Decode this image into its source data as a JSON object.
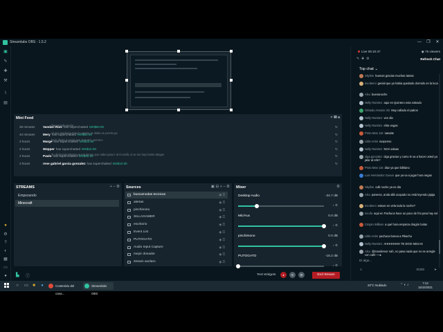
{
  "window": {
    "title": "Streamlabs OBS - 1.5.2",
    "controls": [
      "—",
      "❐",
      "✕"
    ]
  },
  "nav": {
    "items": [
      "studio-icon",
      "editor-icon",
      "themes-icon",
      "apps-icon",
      "stats-icon",
      "layout-icon"
    ],
    "bottom_items": [
      "dashboard-icon",
      "settings-icon",
      "help-icon",
      "theme-icon",
      "grid-icon",
      "chat-icon",
      "user-icon"
    ]
  },
  "mini_feed": {
    "title": "Mini Feed",
    "tools": "⏷  ❚❚  ■",
    "rows": [
      {
        "time": "39 minutes",
        "user": "Vandari Rios",
        "verb": "has superchatted",
        "amount": "MX$50.00",
        "message": "diner madrugador"
      },
      {
        "time": "43 minutes",
        "user": "Mery",
        "verb": "has superchatted",
        "amount": "MX$50.00",
        "message": "Al que madruga Dios lo ayuda, la diaba un perrito pa"
      },
      {
        "time": "3 hours",
        "user": "Marge",
        "verb": "has superchatted",
        "amount": "MX$20.00",
        "message": "ke le digan a Linsa que ama ES, Homero"
      },
      {
        "time": "2 hours",
        "user": "Wepper",
        "verb": "has superchatted",
        "amount": "MX$10.00",
        "message": ""
      },
      {
        "time": "2 hours",
        "user": "Paulo",
        "verb": "has superchatted",
        "amount": "MX$50.00",
        "message": "Tu dicionario Megas ya me tienes que caliar para ir al Crossfit, si se me hay bonito Megas"
      },
      {
        "time": "3 hours",
        "user": "rene gabriel garcia gonzalez",
        "verb": "has superchatted",
        "amount": "MX$10.00",
        "message": ""
      }
    ]
  },
  "scenes": {
    "title": "STREAMS",
    "tools": "+  −  ⚙",
    "items": [
      "Empezando",
      "Minecraft"
    ],
    "active": 1
  },
  "sources": {
    "title": "Sources",
    "tools": "▣  ⊟  +  −  ⚙",
    "items": [
      "buscamodas tecnicas",
      "alertas",
      "pinchinono",
      "SILLAGAMER",
      "escritorio",
      "Event List",
      "PUTOGATO",
      "Audio Input Capture",
      "mejor donador",
      "stream avelaro"
    ],
    "active": 0
  },
  "mixer": {
    "title": "Mixer",
    "tools": "⚙",
    "channels": [
      {
        "name": "Desktop Audio",
        "db": "-34.7 dB",
        "level": 0.22
      },
      {
        "name": "Mic/Aux",
        "db": "0.0 dB",
        "level": 1.0
      },
      {
        "name": "pinchimono",
        "db": "0.0 dB",
        "level": 1.0
      },
      {
        "name": "PUTOGATO",
        "db": "-18.2 dB",
        "level": 0.0
      }
    ]
  },
  "footer": {
    "test_widgets": "Test Widgets",
    "end_stream": "End Stream"
  },
  "chat": {
    "live": "Live 06:10:47",
    "viewers": "75 viewers",
    "refresh": "Refresh Chat",
    "top_chat": "Top chat ⌄",
    "messages": [
      {
        "name": "Skyline",
        "text": "buenas gracias muchas tantas",
        "avatar": "#c07a55"
      },
      {
        "name": "mcobemi",
        "text": "genial que ya habia quedado dormido en la luca",
        "avatar": "#d9b07a"
      },
      {
        "name": "Alcu",
        "text": "buenanoche",
        "avatar": "#9aa6ac"
      },
      {
        "name": "Nelly Ramirez",
        "text": "aqui en Quintero esta soleado",
        "avatar": "#b5c4d0"
      },
      {
        "name": "Orlando Antonio VD",
        "text": "Muy callado el patron",
        "avatar": "#3aa36d"
      },
      {
        "name": "Nelly Ramirez",
        "text": "ven dia",
        "avatar": "#b5c4d0"
      },
      {
        "name": "Nelly Ramirez",
        "text": "ehta vegas",
        "avatar": "#b5c4d0"
      },
      {
        "name": "Proto Man 115",
        "text": "nanaite",
        "avatar": "#c85a3b"
      },
      {
        "name": "Little Artist",
        "text": "suspenso",
        "avatar": "#9aa6ac"
      },
      {
        "name": "Nelly Ramirez",
        "text": "NOA saluas",
        "avatar": "#b5c4d0"
      },
      {
        "name": "olga gonzalez",
        "text": "olga gracias y como le va a hacer usted ya jalar al refe?",
        "avatar": "#9aa6ac"
      },
      {
        "name": "Proto Man 115",
        "text": "diaz ya que bibliano",
        "avatar": "#c85a3b"
      },
      {
        "name": "Luis Hernández Gueva",
        "text": "que ya va a jugar hora negas",
        "avatar": "#3a7bd5"
      },
      {
        "name": "Skyline",
        "text": "culli noche ya es dia",
        "avatar": "#c07a55"
      },
      {
        "name": "Alcu",
        "text": "pareeso, anda allá ocupado no está leyendo jajaja",
        "avatar": "#9aa6ac"
      },
      {
        "name": "mcobemi",
        "text": "estuve en vela toda la noche?",
        "avatar": "#d9b07a"
      },
      {
        "name": "mcofa",
        "text": "aqui en Pachuca hace un poco de frio para hay sol",
        "avatar": "#9aa6ac"
      },
      {
        "name": "Crispin William",
        "text": "a qué hora empieza dragón bolas",
        "avatar": "#c85a3b"
      },
      {
        "name": "Little Artist",
        "text": "pachuca bonea a Pikachu",
        "avatar": "#9aa6ac"
      },
      {
        "name": "Nelly Ramirez",
        "text": "AHHHHHHH TE DOXI NEGAS",
        "avatar": "#b5c4d0"
      },
      {
        "name": "Alcu",
        "text": "@mandervor nah, no pasa nada que no se arregle con café ~~●",
        "avatar": "#9aa6ac"
      }
    ],
    "input_placeholder": "Di algo...",
    "counter": "0/200"
  },
  "taskbar": {
    "apps": [
      {
        "label": "Contenido del cana...",
        "color": "#e04a3a"
      },
      {
        "label": "Streamlabs OBS",
        "color": "#31c3a2"
      }
    ],
    "weather": "20°C  Nublado",
    "time": "7:13",
    "date": "15/10/2021"
  }
}
